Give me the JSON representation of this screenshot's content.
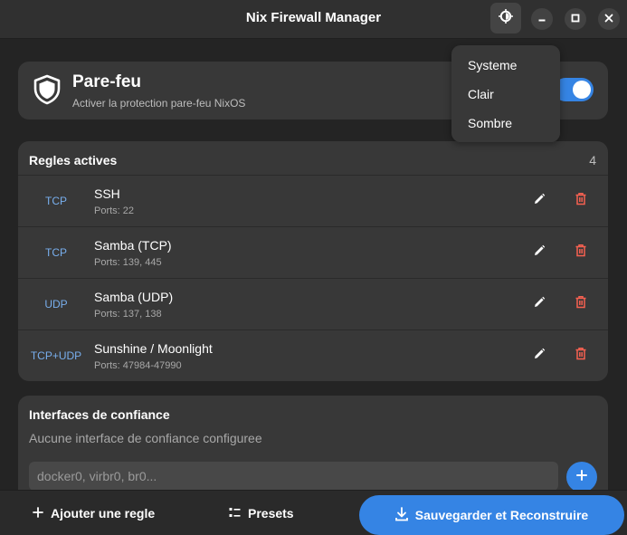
{
  "window": {
    "title": "Nix Firewall Manager"
  },
  "firewall": {
    "title": "Pare-feu",
    "subtitle": "Activer la protection pare-feu NixOS",
    "enabled": true
  },
  "theme_menu": {
    "items": [
      "Systeme",
      "Clair",
      "Sombre"
    ]
  },
  "rules": {
    "heading": "Regles actives",
    "count": "4",
    "items": [
      {
        "protocol": "TCP",
        "name": "SSH",
        "ports": "Ports: 22"
      },
      {
        "protocol": "TCP",
        "name": "Samba (TCP)",
        "ports": "Ports: 139, 445"
      },
      {
        "protocol": "UDP",
        "name": "Samba (UDP)",
        "ports": "Ports: 137, 138"
      },
      {
        "protocol": "TCP+UDP",
        "name": "Sunshine / Moonlight",
        "ports": "Ports: 47984-47990"
      }
    ]
  },
  "interfaces": {
    "heading": "Interfaces de confiance",
    "empty_text": "Aucune interface de confiance configuree",
    "input_placeholder": "docker0, virbr0, br0..."
  },
  "bottom": {
    "add_rule": "Ajouter une regle",
    "presets": "Presets",
    "save": "Sauvegarder et Reconstruire"
  },
  "colors": {
    "accent": "#3584e4",
    "protocol": "#78aeed",
    "danger": "#f66151"
  },
  "icons": {
    "theme": "brightness-icon",
    "minimize": "minimize-icon",
    "maximize": "maximize-icon",
    "close": "close-icon",
    "shield": "shield-icon",
    "edit": "pencil-icon",
    "delete": "trash-icon",
    "add": "plus-icon",
    "presets": "list-icon",
    "save": "download-icon"
  }
}
